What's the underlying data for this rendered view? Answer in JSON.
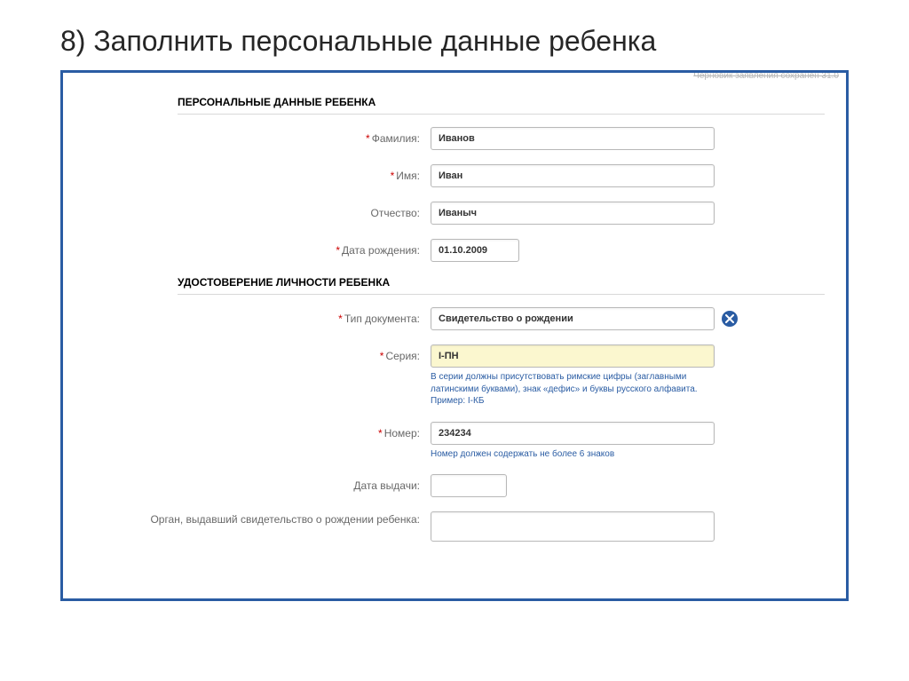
{
  "slide": {
    "title": "8) Заполнить персональные данные ребенка"
  },
  "status": {
    "draft_saved": "Черновик заявления сохранен 31.0"
  },
  "sections": {
    "personal": {
      "header": "ПЕРСОНАЛЬНЫЕ ДАННЫЕ РЕБЕНКА",
      "surname_label": "Фамилия:",
      "surname_value": "Иванов",
      "name_label": "Имя:",
      "name_value": "Иван",
      "patronymic_label": "Отчество:",
      "patronymic_value": "Иваныч",
      "birthdate_label": "Дата рождения:",
      "birthdate_value": "01.10.2009"
    },
    "identity": {
      "header": "УДОСТОВЕРЕНИЕ ЛИЧНОСТИ РЕБЕНКА",
      "doctype_label": "Тип документа:",
      "doctype_value": "Свидетельство о рождении",
      "series_label": "Серия:",
      "series_value": "I-ПН",
      "series_hint": "В серии должны присутствовать римские цифры (заглавными латинскими буквами), знак «дефис» и буквы русского алфавита. Пример: I-КБ",
      "number_label": "Номер:",
      "number_value": "234234",
      "number_hint": "Номер должен содержать не более 6 знаков",
      "issue_date_label": "Дата выдачи:",
      "issue_date_value": "",
      "issuer_label": "Орган, выдавший свидетельство о рождении ребенка:",
      "issuer_value": ""
    }
  }
}
